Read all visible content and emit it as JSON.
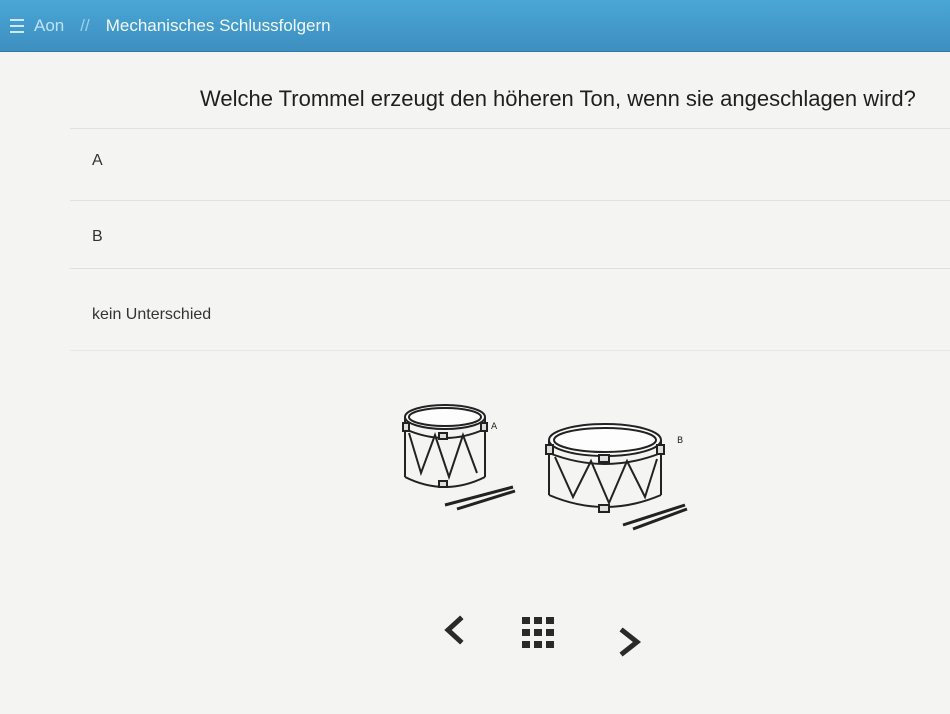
{
  "header": {
    "brand": "Aon",
    "separator": "//",
    "title": "Mechanisches Schlussfolgern",
    "bar_color": "#3f95c7"
  },
  "question": {
    "text": "Welche Trommel erzeugt den höheren Ton, wenn sie angeschlagen wird?"
  },
  "options": [
    {
      "label": "A"
    },
    {
      "label": "B"
    },
    {
      "label": "kein Unterschied"
    }
  ],
  "illustration": {
    "label_a": "A",
    "label_b": "B"
  },
  "navigation": {
    "prev_icon": "chevron-left-icon",
    "grid_icon": "grid-icon",
    "next_icon": "chevron-right-icon"
  }
}
